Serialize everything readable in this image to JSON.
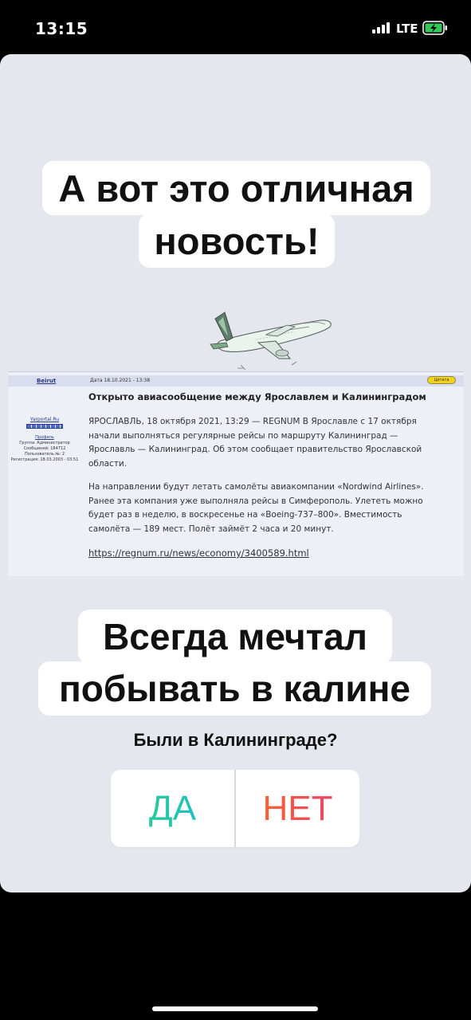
{
  "status_bar": {
    "time": "13:15",
    "network": "LTE",
    "battery_icon": "battery-charging-icon"
  },
  "story": {
    "headline_line1": "А вот это отличная",
    "headline_line2": "новость!",
    "plane_icon": "airplane-drawing",
    "forum_post": {
      "author": "Beirut",
      "date": "Дата 18.10.2021 - 13:38",
      "quote_button": "Цитата",
      "sidebar": {
        "site": "Yarportal.Ru",
        "profile": "Профиль",
        "group": "Группа: Администратор",
        "messages": "Сообщений: 184712",
        "user_no": "Пользователь №: 2",
        "registered": "Регистрация: 18.03.2003 - 03:51"
      },
      "title": "Открыто авиасообщение между Ярославлем и Калининградом",
      "paragraph1": "ЯРОСЛАВЛЬ, 18 октября 2021, 13:29 — REGNUM В Ярославле с 17 октября начали выполняться регулярные рейсы по маршруту Калининград — Ярославль — Калининград. Об этом сообщает правительство Ярославской области.",
      "paragraph2": "На направлении будут летать самолёты авиакомпании «Nordwind Airlines». Ранее эта компания уже выполняла рейсы в Симферополь. Улететь можно будет раз в неделю, в воскресенье на «Boeing-737–800». Вместимость самолёта — 189 мест. Полёт займёт 2 часа и 20 минут.",
      "link": "https://regnum.ru/news/economy/3400589.html"
    },
    "caption_line1": "Всегда мечтал",
    "caption_line2": "побывать в калине",
    "poll": {
      "question": "Были в Калининграде?",
      "option_yes": "ДА",
      "option_no": "НЕТ"
    }
  },
  "colors": {
    "story_background": "#e4e7ee",
    "yes_gradient": [
      "#2fd27a",
      "#19b8e0"
    ],
    "no_gradient": [
      "#ff6a1f",
      "#e8397a"
    ]
  }
}
